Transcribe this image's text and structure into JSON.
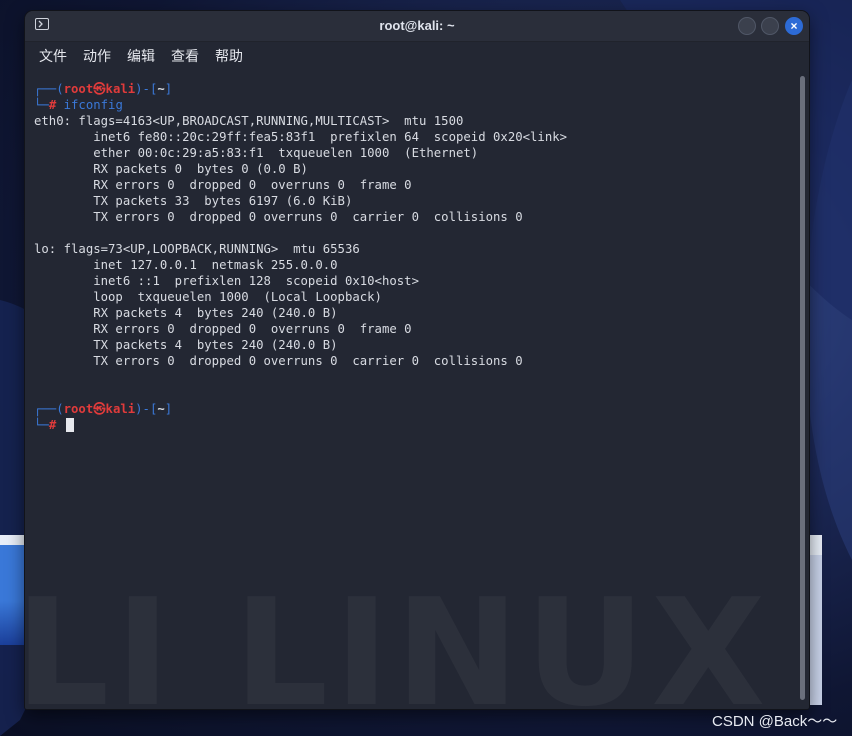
{
  "window": {
    "title": "root@kali: ~",
    "close_glyph": "×"
  },
  "menu": {
    "items": [
      "文件",
      "动作",
      "编辑",
      "查看",
      "帮助"
    ]
  },
  "prompt": {
    "open": "┌──(",
    "user": "root㉿kali",
    "close_mid": ")-[",
    "dir": "~",
    "close": "]",
    "second": "└─",
    "hash": "#"
  },
  "command": "ifconfig",
  "output": [
    "eth0: flags=4163<UP,BROADCAST,RUNNING,MULTICAST>  mtu 1500",
    "        inet6 fe80::20c:29ff:fea5:83f1  prefixlen 64  scopeid 0x20<link>",
    "        ether 00:0c:29:a5:83:f1  txqueuelen 1000  (Ethernet)",
    "        RX packets 0  bytes 0 (0.0 B)",
    "        RX errors 0  dropped 0  overruns 0  frame 0",
    "        TX packets 33  bytes 6197 (6.0 KiB)",
    "        TX errors 0  dropped 0 overruns 0  carrier 0  collisions 0",
    "",
    "lo: flags=73<UP,LOOPBACK,RUNNING>  mtu 65536",
    "        inet 127.0.0.1  netmask 255.0.0.0",
    "        inet6 ::1  prefixlen 128  scopeid 0x10<host>",
    "        loop  txqueuelen 1000  (Local Loopback)",
    "        RX packets 4  bytes 240 (240.0 B)",
    "        RX errors 0  dropped 0  overruns 0  frame 0",
    "        TX packets 4  bytes 240 (240.0 B)",
    "        TX errors 0  dropped 0 overruns 0  carrier 0  collisions 0"
  ],
  "watermark": "LI LINUX",
  "credit": "CSDN @Back～～",
  "colors": {
    "prompt_box": "#3a78d8",
    "prompt_user": "#e03b3b",
    "terminal_bg": "#232733",
    "close_button": "#2d6bd6"
  }
}
